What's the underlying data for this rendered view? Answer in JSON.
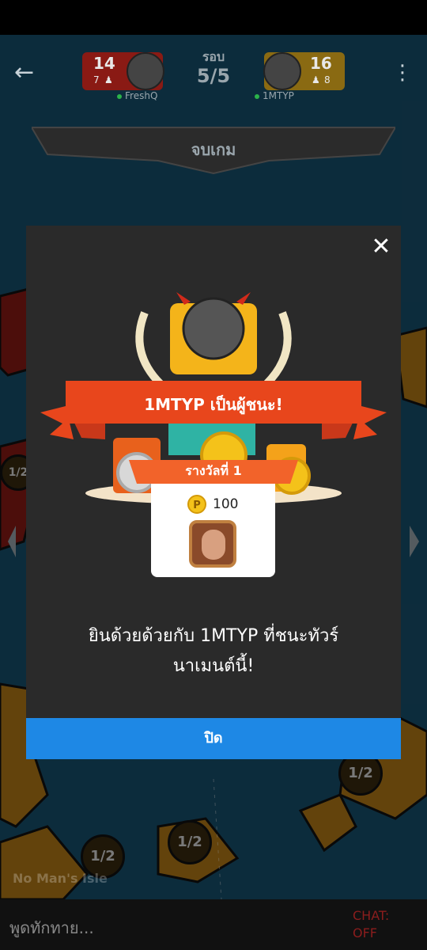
{
  "header": {
    "round_label": "รอบ",
    "round_value": "5/5",
    "left_player": {
      "score": "14",
      "sub": "7",
      "name": "FreshQ"
    },
    "right_player": {
      "score": "16",
      "sub": "8",
      "name": "1MTYP"
    },
    "end_banner": "จบเกม"
  },
  "modal": {
    "winner_text": "1MTYP เป็นผู้ชนะ!",
    "prize_tab": "รางวัลที่ 1",
    "coin_symbol": "P",
    "coin_amount": "100",
    "congrats_line1": "ยินด้วยด้วยกับ 1MTYP ที่ชนะทัวร์",
    "congrats_line2": "นาเมนต์นี้!",
    "close_button": "ปิด"
  },
  "map": {
    "tile_labels": [
      "1/2",
      "1/2",
      "1/2",
      "1/2"
    ],
    "isle_name": "No Man's Isle"
  },
  "chat": {
    "placeholder": "พูดทักทาย...",
    "status_line1": "CHAT:",
    "status_line2": "OFF"
  },
  "colors": {
    "ribbon": "#e8461c",
    "button": "#1e88e5",
    "modal_bg": "#2a2a2a"
  }
}
